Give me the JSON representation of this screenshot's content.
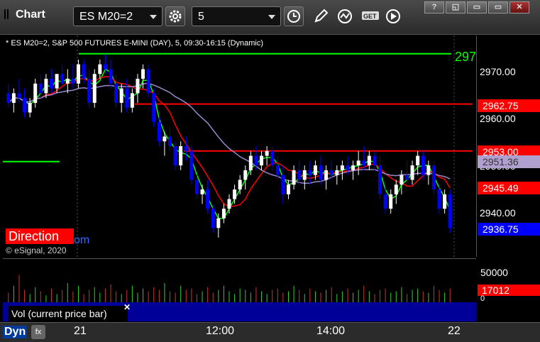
{
  "window": {
    "title": "Chart",
    "symbol": "ES M20=2",
    "interval": "5",
    "controls": [
      "?",
      "◱",
      "▭",
      "✕"
    ]
  },
  "chart_info": "* ES M20=2, S&P 500 FUTURES E-MINI (DAY), 5, 09:30-16:15 (Dynamic)",
  "price_axis": {
    "ticks": [
      "2970.00",
      "2960.00",
      "2950.00",
      "2940.00"
    ],
    "top_level": "297"
  },
  "price_tags": [
    {
      "label": "2962.75",
      "color": "#ff0000"
    },
    {
      "label": "2953.00",
      "color": "#ff0000"
    },
    {
      "label": "2951.36",
      "color": "#b0a0d0"
    },
    {
      "label": "2945.49",
      "color": "#ff0000"
    },
    {
      "label": "2936.75",
      "color": "#0000ff"
    }
  ],
  "overlay": {
    "direction": "Direction",
    "watermark_suffix": "om",
    "copyright": "© eSignal, 2020"
  },
  "volume": {
    "tick": "50000",
    "current": "17012",
    "zero": "0",
    "legend": "Vol (current price bar)"
  },
  "x_axis": {
    "labels": [
      "21",
      "12:00",
      "14:00",
      "22"
    ]
  },
  "status": {
    "dyn": "Dyn",
    "icon": "fx"
  },
  "colors": {
    "up_candle": "#ffffff",
    "down_candle": "#0000ff",
    "green_ma": "#00ff00",
    "red_ma": "#ff0000",
    "purple_ma": "#9988cc",
    "background": "#000000"
  },
  "chart_data": {
    "type": "candlestick",
    "ylim": [
      2931,
      2977
    ],
    "levels": [
      {
        "name": "green",
        "value": 2973.2
      },
      {
        "name": "red-upper",
        "value": 2962.75
      },
      {
        "name": "red-lower",
        "value": 2953.0
      }
    ],
    "candles": [
      [
        2965,
        2967,
        2962,
        2963
      ],
      [
        2963,
        2966,
        2961,
        2965
      ],
      [
        2965,
        2968,
        2963,
        2964
      ],
      [
        2964,
        2966,
        2960,
        2961
      ],
      [
        2961,
        2964,
        2960,
        2963
      ],
      [
        2963,
        2968,
        2962,
        2967
      ],
      [
        2967,
        2969,
        2964,
        2965
      ],
      [
        2965,
        2969,
        2964,
        2968
      ],
      [
        2968,
        2970,
        2965,
        2966
      ],
      [
        2966,
        2969,
        2965,
        2969
      ],
      [
        2969,
        2971,
        2966,
        2967
      ],
      [
        2967,
        2970,
        2965,
        2968
      ],
      [
        2968,
        2971,
        2966,
        2967
      ],
      [
        2967,
        2972,
        2966,
        2971
      ],
      [
        2971,
        2972,
        2967,
        2968
      ],
      [
        2968,
        2970,
        2962,
        2963
      ],
      [
        2963,
        2970,
        2962,
        2969
      ],
      [
        2969,
        2972,
        2968,
        2971
      ],
      [
        2971,
        2973,
        2969,
        2970
      ],
      [
        2970,
        2972,
        2966,
        2967
      ],
      [
        2967,
        2969,
        2962,
        2963
      ],
      [
        2963,
        2967,
        2961,
        2966
      ],
      [
        2966,
        2968,
        2961,
        2962
      ],
      [
        2962,
        2966,
        2961,
        2965
      ],
      [
        2965,
        2969,
        2963,
        2968
      ],
      [
        2968,
        2971,
        2966,
        2970
      ],
      [
        2970,
        2971,
        2964,
        2965
      ],
      [
        2965,
        2966,
        2958,
        2959
      ],
      [
        2959,
        2960,
        2954,
        2955
      ],
      [
        2955,
        2957,
        2952,
        2956
      ],
      [
        2956,
        2958,
        2953,
        2954
      ],
      [
        2954,
        2955,
        2949,
        2950
      ],
      [
        2950,
        2955,
        2949,
        2954
      ],
      [
        2954,
        2956,
        2951,
        2953
      ],
      [
        2953,
        2954,
        2946,
        2947
      ],
      [
        2947,
        2948,
        2943,
        2944
      ],
      [
        2944,
        2946,
        2942,
        2945
      ],
      [
        2945,
        2947,
        2940,
        2941
      ],
      [
        2941,
        2942,
        2936,
        2937
      ],
      [
        2937,
        2940,
        2935,
        2939
      ],
      [
        2939,
        2942,
        2938,
        2941
      ],
      [
        2941,
        2944,
        2940,
        2943
      ],
      [
        2943,
        2946,
        2942,
        2945
      ],
      [
        2945,
        2948,
        2944,
        2947
      ],
      [
        2947,
        2950,
        2945,
        2949
      ],
      [
        2949,
        2953,
        2948,
        2952
      ],
      [
        2952,
        2954,
        2949,
        2950
      ],
      [
        2950,
        2953,
        2949,
        2952
      ],
      [
        2952,
        2954,
        2950,
        2953
      ],
      [
        2953,
        2954,
        2949,
        2950
      ],
      [
        2950,
        2952,
        2947,
        2948
      ],
      [
        2948,
        2950,
        2942,
        2944
      ],
      [
        2944,
        2947,
        2943,
        2946
      ],
      [
        2946,
        2950,
        2945,
        2949
      ],
      [
        2949,
        2951,
        2946,
        2947
      ],
      [
        2947,
        2950,
        2945,
        2949
      ],
      [
        2949,
        2951,
        2946,
        2948
      ],
      [
        2948,
        2951,
        2947,
        2950
      ],
      [
        2950,
        2952,
        2946,
        2947
      ],
      [
        2947,
        2950,
        2945,
        2949
      ],
      [
        2949,
        2951,
        2947,
        2948
      ],
      [
        2948,
        2950,
        2946,
        2949
      ],
      [
        2949,
        2951,
        2947,
        2950
      ],
      [
        2950,
        2952,
        2948,
        2949
      ],
      [
        2949,
        2951,
        2947,
        2950
      ],
      [
        2950,
        2953,
        2948,
        2951
      ],
      [
        2951,
        2954,
        2949,
        2950
      ],
      [
        2950,
        2953,
        2949,
        2952
      ],
      [
        2952,
        2953,
        2949,
        2950
      ],
      [
        2950,
        2952,
        2943,
        2944
      ],
      [
        2944,
        2946,
        2940,
        2941
      ],
      [
        2941,
        2945,
        2940,
        2944
      ],
      [
        2944,
        2947,
        2942,
        2946
      ],
      [
        2946,
        2949,
        2944,
        2948
      ],
      [
        2948,
        2951,
        2946,
        2947
      ],
      [
        2947,
        2951,
        2946,
        2950
      ],
      [
        2950,
        2953,
        2948,
        2952
      ],
      [
        2952,
        2953,
        2947,
        2948
      ],
      [
        2948,
        2951,
        2946,
        2950
      ],
      [
        2950,
        2951,
        2944,
        2945
      ],
      [
        2945,
        2946,
        2940,
        2941
      ],
      [
        2941,
        2945,
        2940,
        2944
      ],
      [
        2944,
        2945,
        2936,
        2937
      ]
    ],
    "volumes": [
      7,
      12,
      20,
      9,
      6,
      11,
      8,
      5,
      10,
      6,
      9,
      14,
      8,
      12,
      6,
      9,
      11,
      7,
      10,
      13,
      8,
      6,
      9,
      12,
      7,
      10,
      8,
      11,
      9,
      14,
      8,
      7,
      12,
      9,
      10,
      6,
      8,
      11,
      7,
      9,
      12,
      8,
      6,
      10,
      9,
      7,
      11,
      8,
      6,
      9,
      10,
      7,
      8,
      12,
      9,
      6,
      10,
      8,
      7,
      9,
      11,
      6,
      8,
      10,
      7,
      9,
      12,
      8,
      6,
      9,
      10,
      7,
      8,
      11,
      6,
      9,
      10,
      8,
      7,
      12,
      9,
      7,
      10
    ]
  }
}
